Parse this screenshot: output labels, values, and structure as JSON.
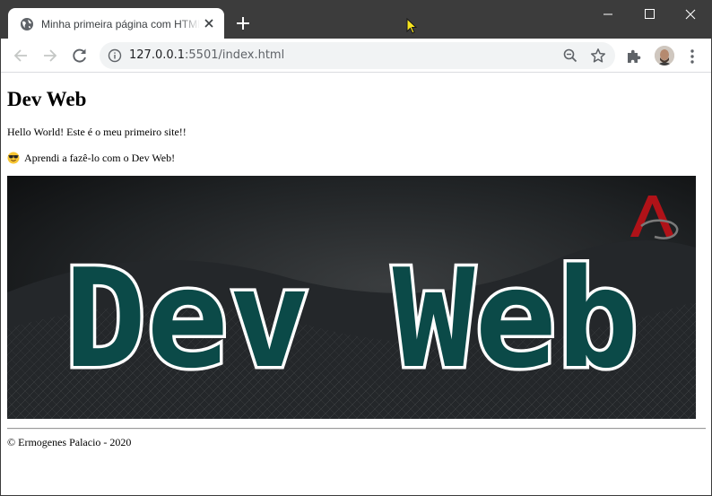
{
  "browser": {
    "tab_title": "Minha primeira página com HTML",
    "url_host": "127.0.0.1",
    "url_rest": ":5501/index.html"
  },
  "page": {
    "heading": "Dev Web",
    "paragraph_1": "Hello World! Este é o meu primeiro site!!",
    "paragraph_2": "Aprendi a fazê-lo com o Dev Web!",
    "banner_text": "Dev Web",
    "footer": "© Ermogenes Palacio - 2020"
  },
  "colors": {
    "titlebar": "#3c3c3c",
    "banner_text_fill": "#0b4a48",
    "banner_text_outline": "#ffffff",
    "logo_red": "#b01218"
  },
  "icons": [
    "globe-icon",
    "close-icon",
    "plus-icon",
    "minimize-icon",
    "maximize-icon",
    "close-window-icon",
    "back-arrow-icon",
    "forward-arrow-icon",
    "reload-icon",
    "info-icon",
    "zoom-icon",
    "star-icon",
    "puzzle-icon",
    "kebab-menu-icon",
    "sunglasses-emoji-icon"
  ]
}
